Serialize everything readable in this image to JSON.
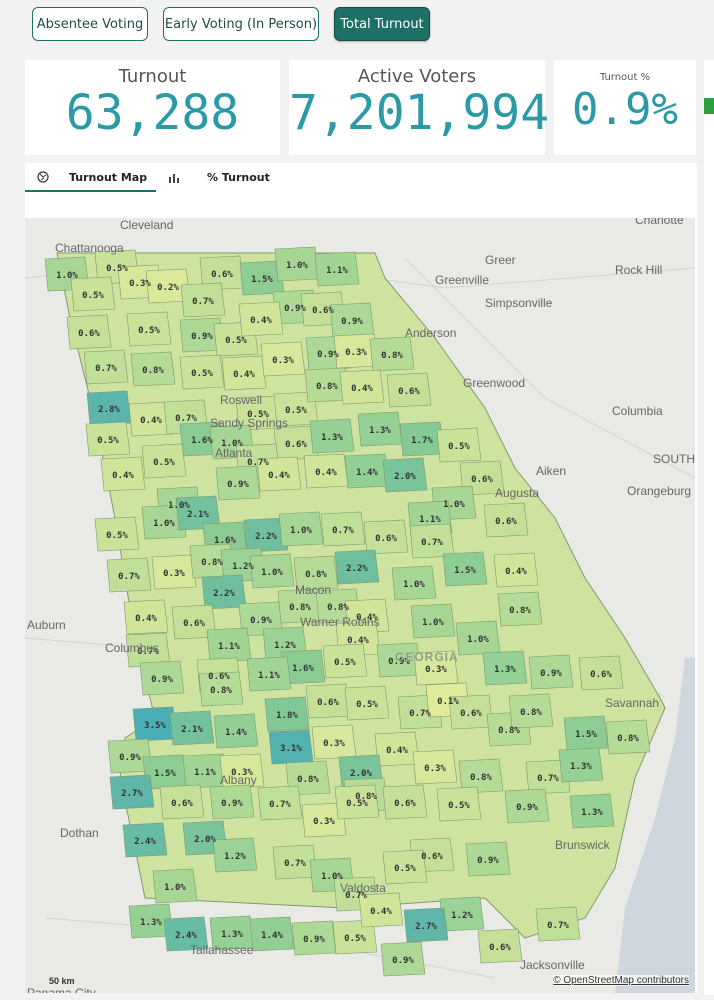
{
  "tabs": {
    "absentee": "Absentee Voting",
    "early": "Early Voting (In Person)",
    "total": "Total Turnout"
  },
  "kpis": {
    "turnout": {
      "label": "Turnout",
      "value": "63,288"
    },
    "active_voters": {
      "label": "Active Voters",
      "value": "7,201,994"
    },
    "turnout_pct": {
      "label": "Turnout %",
      "value": "0.9%"
    }
  },
  "map_tabs": {
    "map": "Turnout Map",
    "pct": "% Turnout"
  },
  "map": {
    "state_label": "GEORGIA",
    "scale": "50 km",
    "attribution": "© OpenStreetMap contributors",
    "cities": [
      "Cleveland",
      "Chattanooga",
      "Charlotte",
      "Greer",
      "Rock Hill",
      "Greenville",
      "Simpsonville",
      "Anderson",
      "Greenwood",
      "Columbia",
      "SOUTH",
      "Aiken",
      "Augusta",
      "Orangeburg",
      "Roswell",
      "Sandy Springs",
      "Atlanta",
      "Macon",
      "Warner Robins",
      "Auburn",
      "Columbus",
      "Savannah",
      "Albany",
      "Dothan",
      "Valdosta",
      "Brunswick",
      "Tallahassee",
      "Jacksonville",
      "Panama City"
    ],
    "colors": {
      "low": "#dbe89a",
      "mid": "#a9d690",
      "high": "#5ab5ae"
    },
    "counties": [
      {
        "v": "1.0%",
        "c": "#a7d694"
      },
      {
        "v": "0.5%",
        "c": "#c9e299"
      },
      {
        "v": "0.3%",
        "c": "#d7e89c"
      },
      {
        "v": "0.2%",
        "c": "#dbe99a"
      },
      {
        "v": "0.6%",
        "c": "#c4e098"
      },
      {
        "v": "1.5%",
        "c": "#8dcd94"
      },
      {
        "v": "1.0%",
        "c": "#a7d694"
      },
      {
        "v": "1.1%",
        "c": "#a2d494"
      },
      {
        "v": "0.5%",
        "c": "#c9e299"
      },
      {
        "v": "0.7%",
        "c": "#c0df98"
      },
      {
        "v": "0.9%",
        "c": "#aed896"
      },
      {
        "v": "0.6%",
        "c": "#c4e098"
      },
      {
        "v": "0.6%",
        "c": "#c4e098"
      },
      {
        "v": "0.5%",
        "c": "#c9e299"
      },
      {
        "v": "0.9%",
        "c": "#aed896"
      },
      {
        "v": "0.5%",
        "c": "#c9e299"
      },
      {
        "v": "0.4%",
        "c": "#d1e59a"
      },
      {
        "v": "0.9%",
        "c": "#aed896"
      },
      {
        "v": "0.7%",
        "c": "#c0df98"
      },
      {
        "v": "0.8%",
        "c": "#b6db96"
      },
      {
        "v": "0.5%",
        "c": "#c9e299"
      },
      {
        "v": "0.4%",
        "c": "#d1e59a"
      },
      {
        "v": "0.3%",
        "c": "#d7e89c"
      },
      {
        "v": "0.9%",
        "c": "#aed896"
      },
      {
        "v": "0.3%",
        "c": "#d7e89c"
      },
      {
        "v": "0.8%",
        "c": "#b6db96"
      },
      {
        "v": "2.8%",
        "c": "#5cb5ac"
      },
      {
        "v": "0.4%",
        "c": "#d1e59a"
      },
      {
        "v": "0.7%",
        "c": "#c0df98"
      },
      {
        "v": "0.5%",
        "c": "#c9e299"
      },
      {
        "v": "0.5%",
        "c": "#c9e299"
      },
      {
        "v": "0.8%",
        "c": "#b6db96"
      },
      {
        "v": "0.4%",
        "c": "#d1e59a"
      },
      {
        "v": "0.6%",
        "c": "#c4e098"
      },
      {
        "v": "0.5%",
        "c": "#c9e299"
      },
      {
        "v": "1.6%",
        "c": "#8acb94"
      },
      {
        "v": "1.0%",
        "c": "#a7d694"
      },
      {
        "v": "0.6%",
        "c": "#c4e098"
      },
      {
        "v": "1.3%",
        "c": "#95d095"
      },
      {
        "v": "1.3%",
        "c": "#95d095"
      },
      {
        "v": "1.7%",
        "c": "#85c994"
      },
      {
        "v": "0.5%",
        "c": "#c9e299"
      },
      {
        "v": "0.4%",
        "c": "#d1e59a"
      },
      {
        "v": "0.5%",
        "c": "#c9e299"
      },
      {
        "v": "0.7%",
        "c": "#c0df98"
      },
      {
        "v": "0.4%",
        "c": "#d1e59a"
      },
      {
        "v": "0.4%",
        "c": "#d1e59a"
      },
      {
        "v": "1.4%",
        "c": "#92cf95"
      },
      {
        "v": "2.0%",
        "c": "#79c49a"
      },
      {
        "v": "0.6%",
        "c": "#c4e098"
      },
      {
        "v": "0.9%",
        "c": "#aed896"
      },
      {
        "v": "1.0%",
        "c": "#a7d694"
      },
      {
        "v": "1.1%",
        "c": "#a2d494"
      },
      {
        "v": "1.0%",
        "c": "#a7d694"
      },
      {
        "v": "0.5%",
        "c": "#c9e299"
      },
      {
        "v": "1.0%",
        "c": "#a7d694"
      },
      {
        "v": "2.1%",
        "c": "#73c19d"
      },
      {
        "v": "1.6%",
        "c": "#8acb94"
      },
      {
        "v": "2.2%",
        "c": "#6fbf9f"
      },
      {
        "v": "1.0%",
        "c": "#a7d694"
      },
      {
        "v": "0.7%",
        "c": "#c0df98"
      },
      {
        "v": "0.6%",
        "c": "#c4e098"
      },
      {
        "v": "0.7%",
        "c": "#c0df98"
      },
      {
        "v": "0.6%",
        "c": "#c4e098"
      },
      {
        "v": "0.7%",
        "c": "#c0df98"
      },
      {
        "v": "0.3%",
        "c": "#d7e89c"
      },
      {
        "v": "0.8%",
        "c": "#b6db96"
      },
      {
        "v": "1.2%",
        "c": "#9bd295"
      },
      {
        "v": "1.0%",
        "c": "#a7d694"
      },
      {
        "v": "0.8%",
        "c": "#b6db96"
      },
      {
        "v": "2.2%",
        "c": "#6fbf9f"
      },
      {
        "v": "1.0%",
        "c": "#a7d694"
      },
      {
        "v": "1.5%",
        "c": "#8dcd94"
      },
      {
        "v": "0.4%",
        "c": "#d1e59a"
      },
      {
        "v": "2.2%",
        "c": "#6fbf9f"
      },
      {
        "v": "0.4%",
        "c": "#d1e59a"
      },
      {
        "v": "0.6%",
        "c": "#c4e098"
      },
      {
        "v": "0.9%",
        "c": "#aed896"
      },
      {
        "v": "0.8%",
        "c": "#b6db96"
      },
      {
        "v": "0.8%",
        "c": "#b6db96"
      },
      {
        "v": "0.4%",
        "c": "#d1e59a"
      },
      {
        "v": "1.0%",
        "c": "#a7d694"
      },
      {
        "v": "0.8%",
        "c": "#b6db96"
      },
      {
        "v": "0.7%",
        "c": "#c0df98"
      },
      {
        "v": "1.1%",
        "c": "#a2d494"
      },
      {
        "v": "1.2%",
        "c": "#9bd295"
      },
      {
        "v": "0.4%",
        "c": "#d1e59a"
      },
      {
        "v": "1.6%",
        "c": "#8acb94"
      },
      {
        "v": "0.5%",
        "c": "#c9e299"
      },
      {
        "v": "0.9%",
        "c": "#aed896"
      },
      {
        "v": "1.0%",
        "c": "#a7d694"
      },
      {
        "v": "0.9%",
        "c": "#aed896"
      },
      {
        "v": "0.6%",
        "c": "#c4e098"
      },
      {
        "v": "0.8%",
        "c": "#b6db96"
      },
      {
        "v": "1.1%",
        "c": "#a2d494"
      },
      {
        "v": "0.3%",
        "c": "#d7e89c"
      },
      {
        "v": "1.3%",
        "c": "#95d095"
      },
      {
        "v": "0.9%",
        "c": "#aed896"
      },
      {
        "v": "0.6%",
        "c": "#c4e098"
      },
      {
        "v": "3.5%",
        "c": "#4aaeb6"
      },
      {
        "v": "2.1%",
        "c": "#73c19d"
      },
      {
        "v": "1.4%",
        "c": "#92cf95"
      },
      {
        "v": "1.8%",
        "c": "#82c896"
      },
      {
        "v": "0.6%",
        "c": "#c4e098"
      },
      {
        "v": "0.5%",
        "c": "#c9e299"
      },
      {
        "v": "0.7%",
        "c": "#c0df98"
      },
      {
        "v": "0.1%",
        "c": "#dfeb9b"
      },
      {
        "v": "0.6%",
        "c": "#c4e098"
      },
      {
        "v": "0.8%",
        "c": "#b6db96"
      },
      {
        "v": "0.8%",
        "c": "#b6db96"
      },
      {
        "v": "3.1%",
        "c": "#53b2b0"
      },
      {
        "v": "0.3%",
        "c": "#d7e89c"
      },
      {
        "v": "0.4%",
        "c": "#d1e59a"
      },
      {
        "v": "1.5%",
        "c": "#8dcd94"
      },
      {
        "v": "0.8%",
        "c": "#b6db96"
      },
      {
        "v": "0.9%",
        "c": "#aed896"
      },
      {
        "v": "1.5%",
        "c": "#8dcd94"
      },
      {
        "v": "1.1%",
        "c": "#a2d494"
      },
      {
        "v": "0.3%",
        "c": "#d7e89c"
      },
      {
        "v": "0.8%",
        "c": "#b6db96"
      },
      {
        "v": "2.0%",
        "c": "#79c49a"
      },
      {
        "v": "0.3%",
        "c": "#d7e89c"
      },
      {
        "v": "0.8%",
        "c": "#b6db96"
      },
      {
        "v": "0.7%",
        "c": "#c0df98"
      },
      {
        "v": "1.3%",
        "c": "#95d095"
      },
      {
        "v": "2.7%",
        "c": "#60b7a9"
      },
      {
        "v": "0.6%",
        "c": "#c4e098"
      },
      {
        "v": "0.9%",
        "c": "#aed896"
      },
      {
        "v": "0.7%",
        "c": "#c0df98"
      },
      {
        "v": "0.8%",
        "c": "#b6db96"
      },
      {
        "v": "0.6%",
        "c": "#c4e098"
      },
      {
        "v": "0.5%",
        "c": "#c9e299"
      },
      {
        "v": "0.9%",
        "c": "#aed896"
      },
      {
        "v": "1.3%",
        "c": "#95d095"
      },
      {
        "v": "0.3%",
        "c": "#d7e89c"
      },
      {
        "v": "0.5%",
        "c": "#c9e299"
      },
      {
        "v": "2.4%",
        "c": "#68bca3"
      },
      {
        "v": "2.0%",
        "c": "#79c49a"
      },
      {
        "v": "1.2%",
        "c": "#9bd295"
      },
      {
        "v": "0.7%",
        "c": "#c0df98"
      },
      {
        "v": "1.0%",
        "c": "#a7d694"
      },
      {
        "v": "0.6%",
        "c": "#c4e098"
      },
      {
        "v": "0.9%",
        "c": "#aed896"
      },
      {
        "v": "1.0%",
        "c": "#a7d694"
      },
      {
        "v": "0.5%",
        "c": "#c9e299"
      },
      {
        "v": "0.7%",
        "c": "#c0df98"
      },
      {
        "v": "1.2%",
        "c": "#9bd295"
      },
      {
        "v": "1.3%",
        "c": "#95d095"
      },
      {
        "v": "2.4%",
        "c": "#68bca3"
      },
      {
        "v": "1.3%",
        "c": "#95d095"
      },
      {
        "v": "1.4%",
        "c": "#92cf95"
      },
      {
        "v": "0.9%",
        "c": "#aed896"
      },
      {
        "v": "0.5%",
        "c": "#c9e299"
      },
      {
        "v": "0.4%",
        "c": "#d1e59a"
      },
      {
        "v": "2.7%",
        "c": "#60b7a9"
      },
      {
        "v": "0.7%",
        "c": "#c0df98"
      },
      {
        "v": "0.9%",
        "c": "#aed896"
      },
      {
        "v": "0.6%",
        "c": "#c4e098"
      }
    ]
  }
}
